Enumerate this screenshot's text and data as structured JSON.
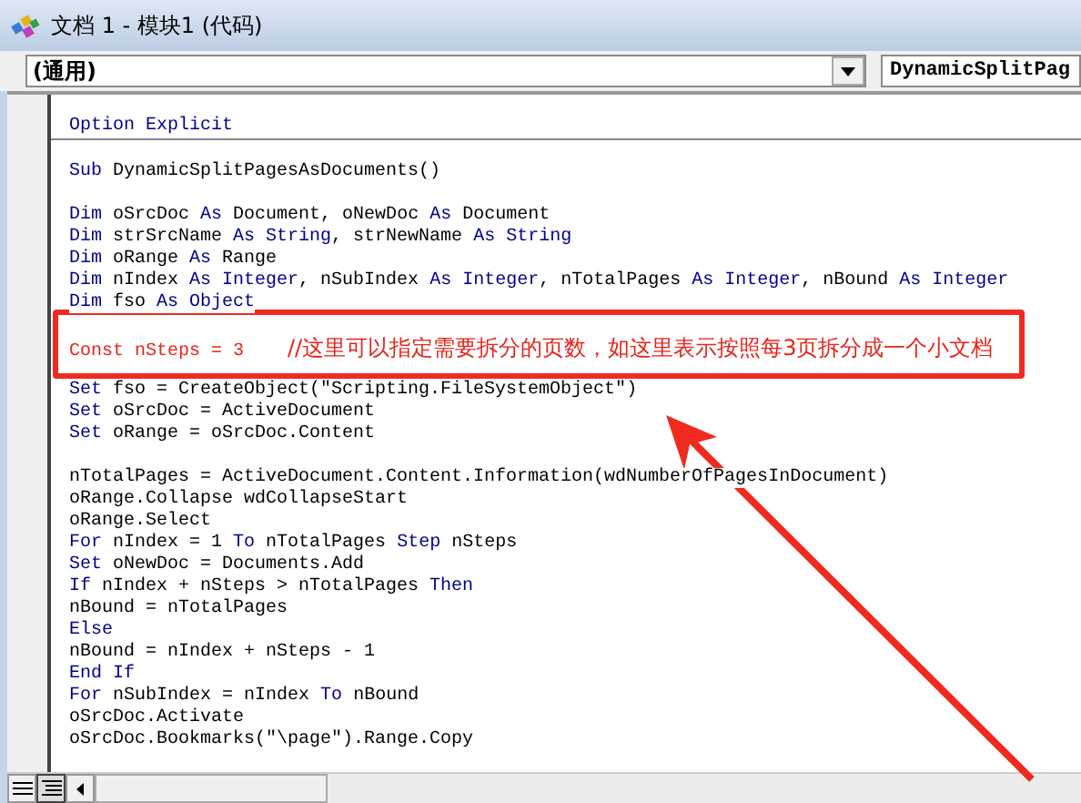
{
  "window": {
    "title": "文档 1 - 模块1 (代码)"
  },
  "object_combo": {
    "value": "(通用)"
  },
  "procedure_combo": {
    "value": "DynamicSplitPag"
  },
  "code_lines": [
    {
      "kind": "code",
      "segments": [
        {
          "kind": "keyword",
          "text": "Option Explicit"
        }
      ]
    },
    {
      "kind": "divider"
    },
    {
      "kind": "blank"
    },
    {
      "kind": "code",
      "segments": [
        {
          "kind": "keyword",
          "text": "Sub"
        },
        {
          "kind": "text",
          "text": " DynamicSplitPagesAsDocuments()"
        }
      ]
    },
    {
      "kind": "blank"
    },
    {
      "kind": "code",
      "segments": [
        {
          "kind": "keyword",
          "text": "Dim"
        },
        {
          "kind": "text",
          "text": " oSrcDoc "
        },
        {
          "kind": "keyword",
          "text": "As"
        },
        {
          "kind": "text",
          "text": " Document, oNewDoc "
        },
        {
          "kind": "keyword",
          "text": "As"
        },
        {
          "kind": "text",
          "text": " Document"
        }
      ]
    },
    {
      "kind": "code",
      "segments": [
        {
          "kind": "keyword",
          "text": "Dim"
        },
        {
          "kind": "text",
          "text": " strSrcName "
        },
        {
          "kind": "keyword",
          "text": "As String"
        },
        {
          "kind": "text",
          "text": ", strNewName "
        },
        {
          "kind": "keyword",
          "text": "As String"
        }
      ]
    },
    {
      "kind": "code",
      "segments": [
        {
          "kind": "keyword",
          "text": "Dim"
        },
        {
          "kind": "text",
          "text": " oRange "
        },
        {
          "kind": "keyword",
          "text": "As"
        },
        {
          "kind": "text",
          "text": " Range"
        }
      ]
    },
    {
      "kind": "code",
      "segments": [
        {
          "kind": "keyword",
          "text": "Dim"
        },
        {
          "kind": "text",
          "text": " nIndex "
        },
        {
          "kind": "keyword",
          "text": "As Integer"
        },
        {
          "kind": "text",
          "text": ", nSubIndex "
        },
        {
          "kind": "keyword",
          "text": "As Integer"
        },
        {
          "kind": "text",
          "text": ", nTotalPages "
        },
        {
          "kind": "keyword",
          "text": "As Integer"
        },
        {
          "kind": "text",
          "text": ", nBound "
        },
        {
          "kind": "keyword",
          "text": "As Integer"
        }
      ]
    },
    {
      "kind": "code",
      "segments": [
        {
          "kind": "keyword",
          "text": "Dim"
        },
        {
          "kind": "text",
          "text": " fso "
        },
        {
          "kind": "keyword",
          "text": "As Object"
        }
      ]
    },
    {
      "kind": "blank"
    },
    {
      "kind": "code",
      "segments": [
        {
          "kind": "annotation",
          "text": "Const nSteps = 3"
        },
        {
          "kind": "note",
          "text": "//这里可以指定需要拆分的页数，如这里表示按照每3页拆分成一个小文档"
        }
      ]
    },
    {
      "kind": "blank"
    },
    {
      "kind": "code",
      "segments": [
        {
          "kind": "keyword",
          "text": "Set"
        },
        {
          "kind": "text",
          "text": " fso = CreateObject(\"Scripting.FileSystemObject\")"
        }
      ]
    },
    {
      "kind": "code",
      "segments": [
        {
          "kind": "keyword",
          "text": "Set"
        },
        {
          "kind": "text",
          "text": " oSrcDoc = ActiveDocument"
        }
      ]
    },
    {
      "kind": "code",
      "segments": [
        {
          "kind": "keyword",
          "text": "Set"
        },
        {
          "kind": "text",
          "text": " oRange = oSrcDoc.Content"
        }
      ]
    },
    {
      "kind": "blank"
    },
    {
      "kind": "code",
      "segments": [
        {
          "kind": "text",
          "text": "nTotalPages = ActiveDocument.Content.Information(wdNumberOfPagesInDocument)"
        }
      ]
    },
    {
      "kind": "code",
      "segments": [
        {
          "kind": "text",
          "text": "oRange.Collapse wdCollapseStart"
        }
      ]
    },
    {
      "kind": "code",
      "segments": [
        {
          "kind": "text",
          "text": "oRange.Select"
        }
      ]
    },
    {
      "kind": "code",
      "segments": [
        {
          "kind": "keyword",
          "text": "For"
        },
        {
          "kind": "text",
          "text": " nIndex = 1 "
        },
        {
          "kind": "keyword",
          "text": "To"
        },
        {
          "kind": "text",
          "text": " nTotalPages "
        },
        {
          "kind": "keyword",
          "text": "Step"
        },
        {
          "kind": "text",
          "text": " nSteps"
        }
      ]
    },
    {
      "kind": "code",
      "segments": [
        {
          "kind": "keyword",
          "text": "Set"
        },
        {
          "kind": "text",
          "text": " oNewDoc = Documents.Add"
        }
      ]
    },
    {
      "kind": "code",
      "segments": [
        {
          "kind": "keyword",
          "text": "If"
        },
        {
          "kind": "text",
          "text": " nIndex + nSteps > nTotalPages "
        },
        {
          "kind": "keyword",
          "text": "Then"
        }
      ]
    },
    {
      "kind": "code",
      "segments": [
        {
          "kind": "text",
          "text": "nBound = nTotalPages"
        }
      ]
    },
    {
      "kind": "code",
      "segments": [
        {
          "kind": "keyword",
          "text": "Else"
        }
      ]
    },
    {
      "kind": "code",
      "segments": [
        {
          "kind": "text",
          "text": "nBound = nIndex + nSteps - 1"
        }
      ]
    },
    {
      "kind": "code",
      "segments": [
        {
          "kind": "keyword",
          "text": "End If"
        }
      ]
    },
    {
      "kind": "code",
      "segments": [
        {
          "kind": "keyword",
          "text": "For"
        },
        {
          "kind": "text",
          "text": " nSubIndex = nIndex "
        },
        {
          "kind": "keyword",
          "text": "To"
        },
        {
          "kind": "text",
          "text": " nBound"
        }
      ]
    },
    {
      "kind": "code",
      "segments": [
        {
          "kind": "text",
          "text": "oSrcDoc.Activate"
        }
      ]
    },
    {
      "kind": "code",
      "segments": [
        {
          "kind": "text",
          "text": "oSrcDoc.Bookmarks(\"\\page\").Range.Copy"
        }
      ]
    }
  ]
}
